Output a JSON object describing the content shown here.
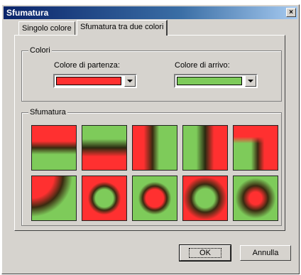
{
  "window": {
    "title": "Sfumatura",
    "close_glyph": "×"
  },
  "tabs": [
    {
      "label": "Singolo colore"
    },
    {
      "label": "Sfumatura tra due colori"
    }
  ],
  "colors_group": {
    "legend": "Colori",
    "start_label": "Colore di partenza:",
    "end_label": "Colore di arrivo:",
    "start_color": "#ff3030",
    "end_color": "#7ecb5a"
  },
  "gradient_group": {
    "legend": "Sfumatura",
    "styles": [
      "horizontal-stripe-red-center",
      "horizontal-stripe-green-center",
      "vertical-stripe-red-center",
      "vertical-stripe-green-center",
      "corner-red",
      "corner-green",
      "square-red-center",
      "square-green-center",
      "radial-green-center",
      "radial-red-center"
    ]
  },
  "buttons": {
    "ok": "OK",
    "cancel": "Annulla"
  },
  "icons": {
    "dropdown": "chevron-down-icon",
    "close": "close-icon"
  }
}
